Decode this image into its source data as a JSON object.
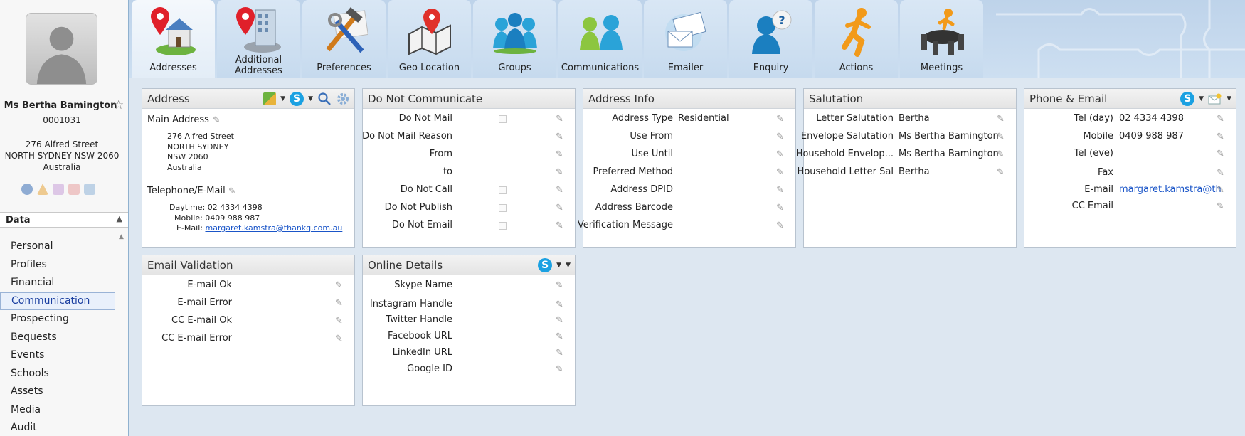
{
  "person": {
    "name": "Ms Bertha Bamington",
    "id": "0001031",
    "address_lines": [
      "276 Alfred Street",
      "NORTH SYDNEY NSW 2060",
      "Australia"
    ]
  },
  "sidebar": {
    "data_header": "Data",
    "items": [
      {
        "label": "Personal"
      },
      {
        "label": "Profiles"
      },
      {
        "label": "Financial"
      },
      {
        "label": "Communication",
        "active": true
      },
      {
        "label": "Prospecting"
      },
      {
        "label": "Bequests"
      },
      {
        "label": "Events"
      },
      {
        "label": "Schools"
      },
      {
        "label": "Assets"
      },
      {
        "label": "Media"
      },
      {
        "label": "Audit"
      }
    ]
  },
  "tabs": [
    {
      "label": "Addresses",
      "icon": "pin-house-icon",
      "active": true
    },
    {
      "label": "Additional Addresses",
      "icon": "pin-building-icon"
    },
    {
      "label": "Preferences",
      "icon": "tools-icon"
    },
    {
      "label": "Geo Location",
      "icon": "map-pin-icon"
    },
    {
      "label": "Groups",
      "icon": "group-people-icon"
    },
    {
      "label": "Communications",
      "icon": "communications-people-icon"
    },
    {
      "label": "Emailer",
      "icon": "envelope-icon"
    },
    {
      "label": "Enquiry",
      "icon": "question-person-icon"
    },
    {
      "label": "Actions",
      "icon": "running-man-icon"
    },
    {
      "label": "Meetings",
      "icon": "meeting-table-icon"
    }
  ],
  "address_panel": {
    "title": "Address",
    "main_label": "Main Address",
    "main_lines": [
      "276 Alfred Street",
      "NORTH SYDNEY",
      "NSW 2060",
      "Australia"
    ],
    "tel_label": "Telephone/E-Mail",
    "daytime": "Daytime: 02 4334 4398",
    "mobile": "Mobile: 0409 988 987",
    "email_label": "E-Mail:",
    "email": "margaret.kamstra@thankq.com.au"
  },
  "dnc_panel": {
    "title": "Do Not Communicate",
    "rows": [
      {
        "label": "Do Not Mail",
        "checkbox": true
      },
      {
        "label": "Do Not Mail Reason",
        "checkbox": false
      },
      {
        "label": "From",
        "checkbox": false
      },
      {
        "label": "to",
        "checkbox": false
      },
      {
        "label": "Do Not Call",
        "checkbox": true
      },
      {
        "label": "Do Not Publish",
        "checkbox": true
      },
      {
        "label": "Do Not Email",
        "checkbox": true
      }
    ]
  },
  "address_info_panel": {
    "title": "Address Info",
    "rows": [
      {
        "label": "Address Type",
        "value": "Residential"
      },
      {
        "label": "Use From",
        "value": ""
      },
      {
        "label": "Use Until",
        "value": ""
      },
      {
        "label": "Preferred Method",
        "value": ""
      },
      {
        "label": "Address DPID",
        "value": ""
      },
      {
        "label": "Address Barcode",
        "value": ""
      },
      {
        "label": "Verification Message",
        "value": ""
      }
    ]
  },
  "salutation_panel": {
    "title": "Salutation",
    "rows": [
      {
        "label": "Letter Salutation",
        "value": "Bertha"
      },
      {
        "label": "Envelope Salutation",
        "value": "Ms Bertha Bamington"
      },
      {
        "label": "Household Envelop...",
        "value": "Ms Bertha Bamington"
      },
      {
        "label": "Household Letter Sal",
        "value": "Bertha"
      }
    ]
  },
  "phone_panel": {
    "title": "Phone & Email",
    "rows": [
      {
        "label": "Tel (day)",
        "value": "02 4334 4398"
      },
      {
        "label": "Mobile",
        "value": "0409 988 987"
      },
      {
        "label": "Tel (eve)",
        "value": ""
      },
      {
        "label": "Fax",
        "value": ""
      },
      {
        "label": "E-mail",
        "value": "margaret.kamstra@th",
        "link": true
      },
      {
        "label": "CC Email",
        "value": ""
      }
    ]
  },
  "email_validation_panel": {
    "title": "Email Validation",
    "rows": [
      {
        "label": "E-mail Ok"
      },
      {
        "label": "E-mail Error"
      },
      {
        "label": "CC E-mail Ok"
      },
      {
        "label": "CC E-mail Error"
      }
    ]
  },
  "online_panel": {
    "title": "Online Details",
    "rows": [
      {
        "label": "Skype Name"
      },
      {
        "label": "Instagram Handle"
      },
      {
        "label": "Twitter Handle"
      },
      {
        "label": "Facebook URL"
      },
      {
        "label": "LinkedIn URL"
      },
      {
        "label": "Google ID"
      }
    ]
  },
  "glyphs": {
    "pencil": "✎",
    "star": "☆",
    "skype": "S",
    "caret_down": "▼",
    "caret_up": "▲"
  }
}
